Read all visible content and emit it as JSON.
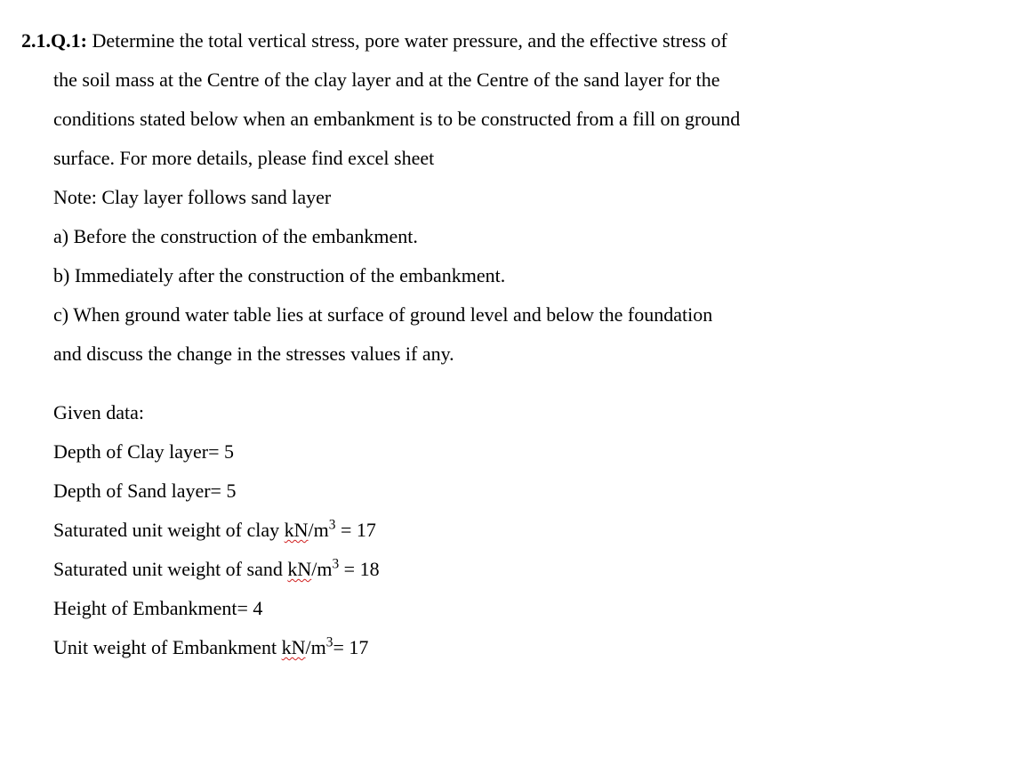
{
  "question": {
    "label": "2.1.Q.1:",
    "intro1": "Determine the total vertical stress, pore water pressure, and the effective stress of",
    "intro2": "the soil mass at the Centre of the clay layer and at the Centre of the sand layer for the",
    "intro3": "conditions stated below when an embankment is to be constructed from a fill on ground",
    "intro4": "surface. For more details, please find excel sheet",
    "note": "Note: Clay layer follows sand layer",
    "part_a": "a) Before the construction of the embankment.",
    "part_b": "b) Immediately after the construction of the embankment.",
    "part_c1": "c) When ground water table lies at surface of ground level and below the foundation",
    "part_c2": "and discuss the change in the stresses values if any."
  },
  "given": {
    "header": "Given data:",
    "clay_depth_label": "Depth of Clay layer= ",
    "clay_depth_value": "5",
    "sand_depth_label": "Depth of Sand layer= ",
    "sand_depth_value": "5",
    "sat_clay_prefix": "Saturated unit weight of clay ",
    "sat_clay_unit_pre": "kN",
    "sat_clay_unit_post": "/m",
    "sat_clay_exp": "3",
    "sat_clay_eq": " = ",
    "sat_clay_value": "17",
    "sat_sand_prefix": "Saturated unit weight of sand ",
    "sat_sand_unit_pre": "kN",
    "sat_sand_unit_post": "/m",
    "sat_sand_exp": "3",
    "sat_sand_eq": " = ",
    "sat_sand_value": "18",
    "emb_height_label": "Height of Embankment= ",
    "emb_height_value": "4",
    "emb_unit_prefix": "Unit weight of Embankment ",
    "emb_unit_pre": "kN",
    "emb_unit_post": "/m",
    "emb_unit_exp": "3",
    "emb_unit_eq": "= ",
    "emb_unit_value": "17"
  }
}
